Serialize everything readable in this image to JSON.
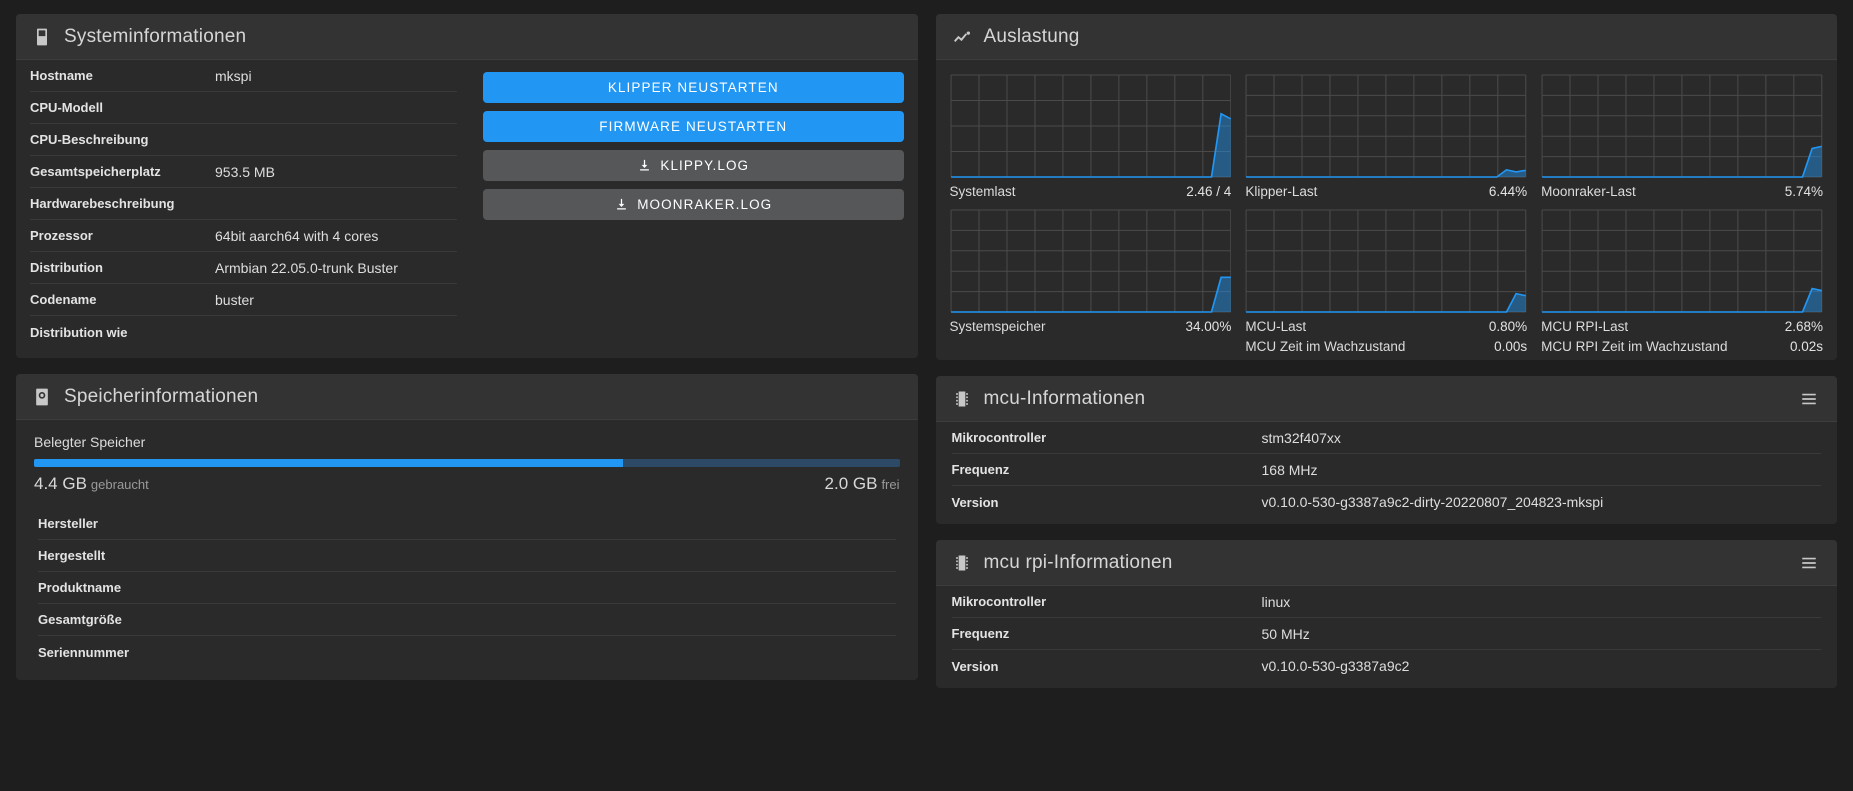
{
  "theme": {
    "bg": "#1e1e1e",
    "card_bg": "#2a2a2a",
    "card_head_bg": "#333333",
    "accent": "#2196f3",
    "secondary_btn": "#555759",
    "text": "#dedede"
  },
  "system_card": {
    "title": "Systeminformationen",
    "icon": "server-tower-icon",
    "rows": [
      {
        "key": "Hostname",
        "value": "mkspi"
      },
      {
        "key": "CPU-Modell",
        "value": ""
      },
      {
        "key": "CPU-Beschreibung",
        "value": ""
      },
      {
        "key": "Gesamtspeicherplatz",
        "value": "953.5 MB"
      },
      {
        "key": "Hardwarebeschreibung",
        "value": ""
      },
      {
        "key": "Prozessor",
        "value": "64bit aarch64 with 4 cores"
      },
      {
        "key": "Distribution",
        "value": "Armbian 22.05.0-trunk Buster"
      },
      {
        "key": "Codename",
        "value": "buster"
      },
      {
        "key": "Distribution wie",
        "value": ""
      }
    ],
    "buttons": [
      {
        "label": "KLIPPER NEUSTARTEN",
        "style": "primary",
        "icon": ""
      },
      {
        "label": "FIRMWARE NEUSTARTEN",
        "style": "primary",
        "icon": ""
      },
      {
        "label": "KLIPPY.LOG",
        "style": "secondary",
        "icon": "download-icon"
      },
      {
        "label": "MOONRAKER.LOG",
        "style": "secondary",
        "icon": "download-icon"
      }
    ]
  },
  "memory_card": {
    "title": "Speicherinformationen",
    "icon": "hard-disk-icon",
    "usage_label": "Belegter Speicher",
    "used_value": "4.4 GB",
    "used_suffix": "gebraucht",
    "free_value": "2.0 GB",
    "free_suffix": "frei",
    "percent": 68,
    "rows": [
      {
        "key": "Hersteller",
        "value": ""
      },
      {
        "key": "Hergestellt",
        "value": ""
      },
      {
        "key": "Produktname",
        "value": ""
      },
      {
        "key": "Gesamtgröße",
        "value": ""
      },
      {
        "key": "Seriennummer",
        "value": ""
      }
    ]
  },
  "utilization_card": {
    "title": "Auslastung",
    "icon": "chart-line-icon"
  },
  "chart_data": [
    {
      "type": "area",
      "title": "Systemlast",
      "value_label": "2.46 / 4",
      "x": [
        0,
        1,
        2,
        3,
        4,
        5,
        6,
        7,
        8,
        9,
        10,
        11,
        12,
        13,
        14,
        15,
        16,
        17,
        18,
        19,
        20,
        21,
        22,
        23,
        24,
        25,
        26,
        27,
        28,
        29
      ],
      "values": [
        0,
        0,
        0,
        0,
        0,
        0,
        0,
        0,
        0,
        0,
        0,
        0,
        0,
        0,
        0,
        0,
        0,
        0,
        0,
        0,
        0,
        0,
        0,
        0,
        0,
        0,
        0,
        0,
        0.62,
        0.57
      ],
      "ylim": [
        0,
        1
      ],
      "grid": true,
      "cols": 10,
      "rows": 4,
      "color": "#2196f3"
    },
    {
      "type": "area",
      "title": "Klipper-Last",
      "value_label": "6.44%",
      "x": [
        0,
        1,
        2,
        3,
        4,
        5,
        6,
        7,
        8,
        9,
        10,
        11,
        12,
        13,
        14,
        15,
        16,
        17,
        18,
        19,
        20,
        21,
        22,
        23,
        24,
        25,
        26,
        27,
        28,
        29
      ],
      "values": [
        0,
        0,
        0,
        0,
        0,
        0,
        0,
        0,
        0,
        0,
        0,
        0,
        0,
        0,
        0,
        0,
        0,
        0,
        0,
        0,
        0,
        0,
        0,
        0,
        0,
        0,
        0,
        0.07,
        0.05,
        0.065
      ],
      "ylim": [
        0,
        1
      ],
      "grid": true,
      "cols": 10,
      "rows": 5,
      "color": "#2196f3"
    },
    {
      "type": "area",
      "title": "Moonraker-Last",
      "value_label": "5.74%",
      "x": [
        0,
        1,
        2,
        3,
        4,
        5,
        6,
        7,
        8,
        9,
        10,
        11,
        12,
        13,
        14,
        15,
        16,
        17,
        18,
        19,
        20,
        21,
        22,
        23,
        24,
        25,
        26,
        27,
        28,
        29
      ],
      "values": [
        0,
        0,
        0,
        0,
        0,
        0,
        0,
        0,
        0,
        0,
        0,
        0,
        0,
        0,
        0,
        0,
        0,
        0,
        0,
        0,
        0,
        0,
        0,
        0,
        0,
        0,
        0,
        0,
        0.28,
        0.3
      ],
      "ylim": [
        0,
        1
      ],
      "grid": true,
      "cols": 10,
      "rows": 5,
      "color": "#2196f3"
    },
    {
      "type": "area",
      "title": "Systemspeicher",
      "value_label": "34.00%",
      "x": [
        0,
        1,
        2,
        3,
        4,
        5,
        6,
        7,
        8,
        9,
        10,
        11,
        12,
        13,
        14,
        15,
        16,
        17,
        18,
        19,
        20,
        21,
        22,
        23,
        24,
        25,
        26,
        27,
        28,
        29
      ],
      "values": [
        0,
        0,
        0,
        0,
        0,
        0,
        0,
        0,
        0,
        0,
        0,
        0,
        0,
        0,
        0,
        0,
        0,
        0,
        0,
        0,
        0,
        0,
        0,
        0,
        0,
        0,
        0,
        0,
        0.34,
        0.34
      ],
      "ylim": [
        0,
        1
      ],
      "grid": true,
      "cols": 10,
      "rows": 5,
      "color": "#2196f3"
    },
    {
      "type": "area",
      "title": "MCU-Last",
      "value_label": "0.80%",
      "second_title": "MCU Zeit im Wachzustand",
      "second_value": "0.00s",
      "x": [
        0,
        1,
        2,
        3,
        4,
        5,
        6,
        7,
        8,
        9,
        10,
        11,
        12,
        13,
        14,
        15,
        16,
        17,
        18,
        19,
        20,
        21,
        22,
        23,
        24,
        25,
        26,
        27,
        28,
        29
      ],
      "values": [
        0,
        0,
        0,
        0,
        0,
        0,
        0,
        0,
        0,
        0,
        0,
        0,
        0,
        0,
        0,
        0,
        0,
        0,
        0,
        0,
        0,
        0,
        0,
        0,
        0,
        0,
        0,
        0,
        0.18,
        0.16
      ],
      "ylim": [
        0,
        1
      ],
      "grid": true,
      "cols": 10,
      "rows": 5,
      "color": "#2196f3"
    },
    {
      "type": "area",
      "title": "MCU RPI-Last",
      "value_label": "2.68%",
      "second_title": "MCU RPI Zeit im Wachzustand",
      "second_value": "0.02s",
      "x": [
        0,
        1,
        2,
        3,
        4,
        5,
        6,
        7,
        8,
        9,
        10,
        11,
        12,
        13,
        14,
        15,
        16,
        17,
        18,
        19,
        20,
        21,
        22,
        23,
        24,
        25,
        26,
        27,
        28,
        29
      ],
      "values": [
        0,
        0,
        0,
        0,
        0,
        0,
        0,
        0,
        0,
        0,
        0,
        0,
        0,
        0,
        0,
        0,
        0,
        0,
        0,
        0,
        0,
        0,
        0,
        0,
        0,
        0,
        0,
        0,
        0.23,
        0.21
      ],
      "ylim": [
        0,
        1
      ],
      "grid": true,
      "cols": 10,
      "rows": 5,
      "color": "#2196f3"
    }
  ],
  "mcu_card": {
    "title": "mcu-Informationen",
    "icon": "chip-icon",
    "menu_icon": "list-menu-icon",
    "rows": [
      {
        "key": "Mikrocontroller",
        "value": "stm32f407xx"
      },
      {
        "key": "Frequenz",
        "value": "168 MHz"
      },
      {
        "key": "Version",
        "value": "v0.10.0-530-g3387a9c2-dirty-20220807_204823-mkspi"
      }
    ]
  },
  "mcu_rpi_card": {
    "title": "mcu rpi-Informationen",
    "icon": "chip-icon",
    "menu_icon": "list-menu-icon",
    "rows": [
      {
        "key": "Mikrocontroller",
        "value": "linux"
      },
      {
        "key": "Frequenz",
        "value": "50 MHz"
      },
      {
        "key": "Version",
        "value": "v0.10.0-530-g3387a9c2"
      }
    ]
  }
}
